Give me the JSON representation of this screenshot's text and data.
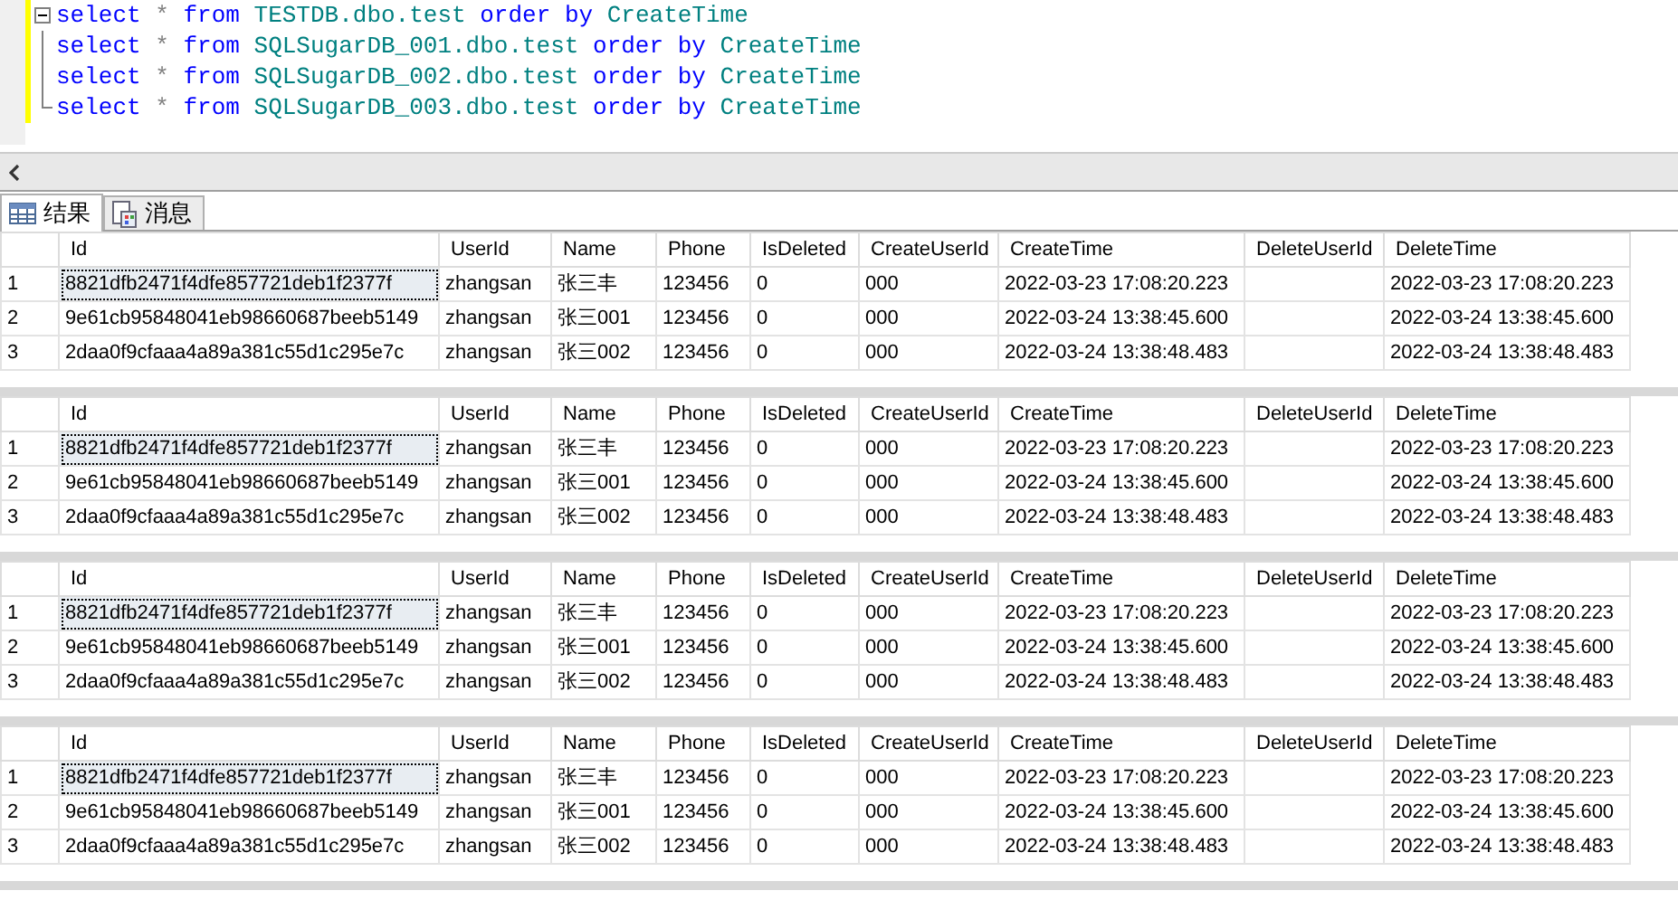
{
  "editor": {
    "lines": [
      {
        "tokens": [
          {
            "kind": "keyword",
            "text": "select"
          },
          {
            "kind": "op",
            "text": "*"
          },
          {
            "kind": "keyword",
            "text": "from"
          },
          {
            "kind": "ident",
            "text": "TESTDB.dbo.test"
          },
          {
            "kind": "keyword",
            "text": "order"
          },
          {
            "kind": "keyword",
            "text": "by"
          },
          {
            "kind": "ident",
            "text": "CreateTime"
          }
        ]
      },
      {
        "tokens": [
          {
            "kind": "keyword",
            "text": "select"
          },
          {
            "kind": "op",
            "text": "*"
          },
          {
            "kind": "keyword",
            "text": "from"
          },
          {
            "kind": "ident",
            "text": "SQLSugarDB_001.dbo.test"
          },
          {
            "kind": "keyword",
            "text": "order"
          },
          {
            "kind": "keyword",
            "text": "by"
          },
          {
            "kind": "ident",
            "text": "CreateTime"
          }
        ]
      },
      {
        "tokens": [
          {
            "kind": "keyword",
            "text": "select"
          },
          {
            "kind": "op",
            "text": "*"
          },
          {
            "kind": "keyword",
            "text": "from"
          },
          {
            "kind": "ident",
            "text": "SQLSugarDB_002.dbo.test"
          },
          {
            "kind": "keyword",
            "text": "order"
          },
          {
            "kind": "keyword",
            "text": "by"
          },
          {
            "kind": "ident",
            "text": "CreateTime"
          }
        ]
      },
      {
        "tokens": [
          {
            "kind": "keyword",
            "text": "select"
          },
          {
            "kind": "op",
            "text": "*"
          },
          {
            "kind": "keyword",
            "text": "from"
          },
          {
            "kind": "ident",
            "text": "SQLSugarDB_003.dbo.test"
          },
          {
            "kind": "keyword",
            "text": "order"
          },
          {
            "kind": "keyword",
            "text": "by"
          },
          {
            "kind": "ident",
            "text": "CreateTime"
          }
        ]
      }
    ]
  },
  "tabs": [
    {
      "label": "结果",
      "kind": "grid",
      "selected": true
    },
    {
      "label": "消息",
      "kind": "messages",
      "selected": false
    }
  ],
  "grids": [
    {
      "columns": [
        "Id",
        "UserId",
        "Name",
        "Phone",
        "IsDeleted",
        "CreateUserId",
        "CreateTime",
        "DeleteUserId",
        "DeleteTime"
      ],
      "rows": [
        {
          "number": "1",
          "selected": true,
          "cells": [
            "8821dfb2471f4dfe857721deb1f2377f",
            "zhangsan",
            "张三丰",
            "123456",
            "0",
            "000",
            "2022-03-23 17:08:20.223",
            "",
            "2022-03-23 17:08:20.223"
          ]
        },
        {
          "number": "2",
          "selected": false,
          "cells": [
            "9e61cb95848041eb98660687beeb5149",
            "zhangsan",
            "张三001",
            "123456",
            "0",
            "000",
            "2022-03-24 13:38:45.600",
            "",
            "2022-03-24 13:38:45.600"
          ]
        },
        {
          "number": "3",
          "selected": false,
          "cells": [
            "2daa0f9cfaaa4a89a381c55d1c295e7c",
            "zhangsan",
            "张三002",
            "123456",
            "0",
            "000",
            "2022-03-24 13:38:48.483",
            "",
            "2022-03-24 13:38:48.483"
          ]
        }
      ]
    },
    {
      "columns": [
        "Id",
        "UserId",
        "Name",
        "Phone",
        "IsDeleted",
        "CreateUserId",
        "CreateTime",
        "DeleteUserId",
        "DeleteTime"
      ],
      "rows": [
        {
          "number": "1",
          "selected": true,
          "cells": [
            "8821dfb2471f4dfe857721deb1f2377f",
            "zhangsan",
            "张三丰",
            "123456",
            "0",
            "000",
            "2022-03-23 17:08:20.223",
            "",
            "2022-03-23 17:08:20.223"
          ]
        },
        {
          "number": "2",
          "selected": false,
          "cells": [
            "9e61cb95848041eb98660687beeb5149",
            "zhangsan",
            "张三001",
            "123456",
            "0",
            "000",
            "2022-03-24 13:38:45.600",
            "",
            "2022-03-24 13:38:45.600"
          ]
        },
        {
          "number": "3",
          "selected": false,
          "cells": [
            "2daa0f9cfaaa4a89a381c55d1c295e7c",
            "zhangsan",
            "张三002",
            "123456",
            "0",
            "000",
            "2022-03-24 13:38:48.483",
            "",
            "2022-03-24 13:38:48.483"
          ]
        }
      ]
    },
    {
      "columns": [
        "Id",
        "UserId",
        "Name",
        "Phone",
        "IsDeleted",
        "CreateUserId",
        "CreateTime",
        "DeleteUserId",
        "DeleteTime"
      ],
      "rows": [
        {
          "number": "1",
          "selected": true,
          "cells": [
            "8821dfb2471f4dfe857721deb1f2377f",
            "zhangsan",
            "张三丰",
            "123456",
            "0",
            "000",
            "2022-03-23 17:08:20.223",
            "",
            "2022-03-23 17:08:20.223"
          ]
        },
        {
          "number": "2",
          "selected": false,
          "cells": [
            "9e61cb95848041eb98660687beeb5149",
            "zhangsan",
            "张三001",
            "123456",
            "0",
            "000",
            "2022-03-24 13:38:45.600",
            "",
            "2022-03-24 13:38:45.600"
          ]
        },
        {
          "number": "3",
          "selected": false,
          "cells": [
            "2daa0f9cfaaa4a89a381c55d1c295e7c",
            "zhangsan",
            "张三002",
            "123456",
            "0",
            "000",
            "2022-03-24 13:38:48.483",
            "",
            "2022-03-24 13:38:48.483"
          ]
        }
      ]
    },
    {
      "columns": [
        "Id",
        "UserId",
        "Name",
        "Phone",
        "IsDeleted",
        "CreateUserId",
        "CreateTime",
        "DeleteUserId",
        "DeleteTime"
      ],
      "rows": [
        {
          "number": "1",
          "selected": true,
          "cells": [
            "8821dfb2471f4dfe857721deb1f2377f",
            "zhangsan",
            "张三丰",
            "123456",
            "0",
            "000",
            "2022-03-23 17:08:20.223",
            "",
            "2022-03-23 17:08:20.223"
          ]
        },
        {
          "number": "2",
          "selected": false,
          "cells": [
            "9e61cb95848041eb98660687beeb5149",
            "zhangsan",
            "张三001",
            "123456",
            "0",
            "000",
            "2022-03-24 13:38:45.600",
            "",
            "2022-03-24 13:38:45.600"
          ]
        },
        {
          "number": "3",
          "selected": false,
          "cells": [
            "2daa0f9cfaaa4a89a381c55d1c295e7c",
            "zhangsan",
            "张三002",
            "123456",
            "0",
            "000",
            "2022-03-24 13:38:48.483",
            "",
            "2022-03-24 13:38:48.483"
          ]
        }
      ]
    }
  ]
}
